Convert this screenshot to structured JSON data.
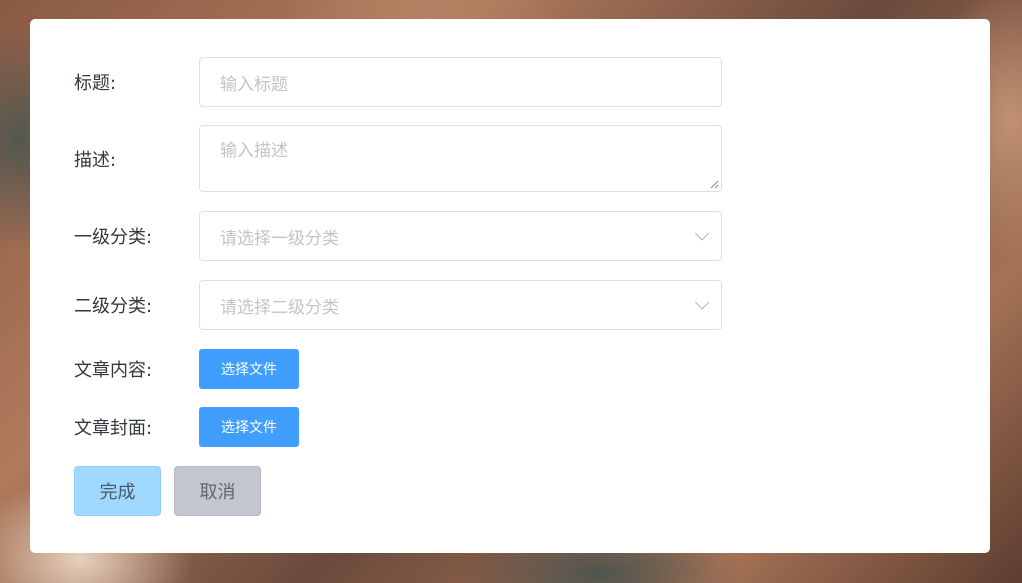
{
  "form": {
    "title": {
      "label": "标题:",
      "placeholder": "输入标题"
    },
    "description": {
      "label": "描述:",
      "placeholder": "输入描述"
    },
    "category1": {
      "label": "一级分类:",
      "placeholder": "请选择一级分类"
    },
    "category2": {
      "label": "二级分类:",
      "placeholder": "请选择二级分类"
    },
    "content": {
      "label": "文章内容:",
      "button": "选择文件"
    },
    "cover": {
      "label": "文章封面:",
      "button": "选择文件"
    }
  },
  "actions": {
    "done": "完成",
    "cancel": "取消"
  },
  "colors": {
    "primary": "#409eff",
    "done_bg": "#a0d9ff",
    "cancel_bg": "#c2c6cf",
    "border": "#dcdfe6",
    "placeholder": "#c0c4cc"
  },
  "icons": {
    "select_arrow": "chevron-down-icon",
    "resize": "resize-grip-icon"
  }
}
